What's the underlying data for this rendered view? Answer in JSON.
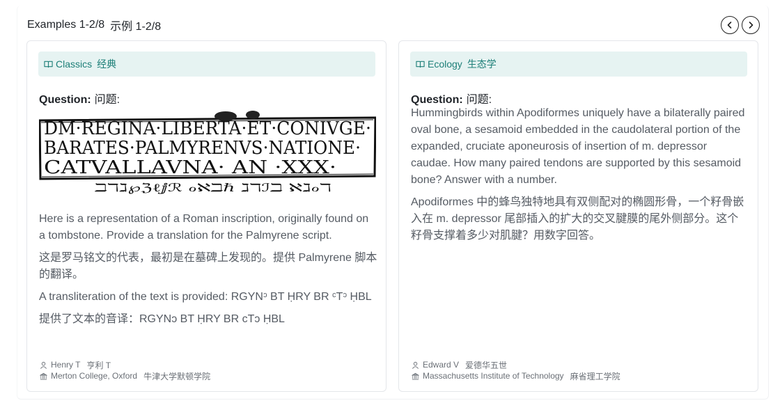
{
  "header": {
    "title_en": "Examples 1-2/8",
    "title_zh": "示例 1-2/8",
    "prev_icon": "chevron-left-icon",
    "next_icon": "chevron-right-icon"
  },
  "colors": {
    "tag_bg": "#e6f3f2",
    "tag_text": "#1d7f78",
    "body_text": "#555b63"
  },
  "cards": [
    {
      "category_en": "Classics",
      "category_zh": "经典",
      "category_icon": "book-icon",
      "question_label_en": "Question:",
      "question_label_zh": "问题:",
      "image": {
        "line1": "DM·REGINA·LIBERTA·ET·CONIVGE·",
        "line2": "BARATES·PALMYRENVS·NATIONE·",
        "line3": "CATVALLAVNA· AN ·XXX·",
        "script": "ℶℸℷ℘ℨℓⅉℛ ℴℵℶℏ ℷℸℐℶ ℵℷℴℸ"
      },
      "text_en": "Here is a representation of a Roman inscription, originally found on a tombstone. Provide a translation for the Palmyrene script.",
      "text_zh": "这是罗马铭文的代表，最初是在墓碑上发现的。提供 Palmyrene 脚本的翻译。",
      "note_en": "A transliteration of the text is provided: RGYNᵓ BT ḤRY BR ᶜTᵓ ḤBL",
      "note_zh": "提供了文本的音译：RGYNɔ BT ḤRY BR cTɔ ḤBL",
      "author_en": "Henry T",
      "author_zh": "亨利 T",
      "affiliation_en": "Merton College, Oxford",
      "affiliation_zh": "牛津大学默顿学院"
    },
    {
      "category_en": "Ecology",
      "category_zh": "生态学",
      "category_icon": "book-icon",
      "question_label_en": "Question:",
      "question_label_zh": "问题:",
      "text_en": "Hummingbirds within Apodiformes uniquely have a bilaterally paired oval bone, a sesamoid embedded in the caudolateral portion of the expanded, cruciate aponeurosis of insertion of m. depressor caudae. How many paired tendons are supported by this sesamoid bone? Answer with a number.",
      "text_zh": "Apodiformes 中的蜂鸟独特地具有双侧配对的椭圆形骨，一个籽骨嵌入在 m. depressor 尾部插入的扩大的交叉腱膜的尾外侧部分。这个籽骨支撑着多少对肌腱？用数字回答。",
      "author_en": "Edward V",
      "author_zh": "爱德华五世",
      "affiliation_en": "Massachusetts Institute of Technology",
      "affiliation_zh": "麻省理工学院"
    }
  ]
}
